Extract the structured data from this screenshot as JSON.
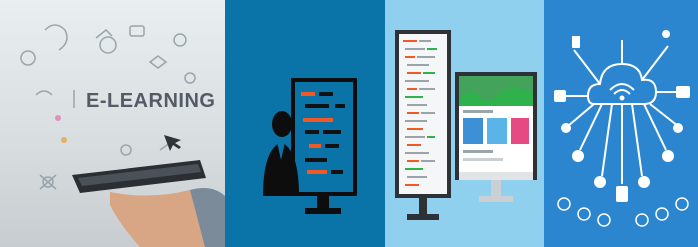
{
  "panels": [
    {
      "name": "e-learning-photo",
      "title": "E-LEARNING",
      "bg": "#dde3e6"
    },
    {
      "name": "presentation-panel",
      "bg": "#0a73a8"
    },
    {
      "name": "web-development-panel",
      "bg": "#8fd0ee"
    },
    {
      "name": "cloud-network-panel",
      "bg": "#2c86cf"
    }
  ],
  "colors": {
    "orange": "#f15a24",
    "dark": "#111111",
    "white": "#ffffff",
    "green": "#2fb24c"
  }
}
